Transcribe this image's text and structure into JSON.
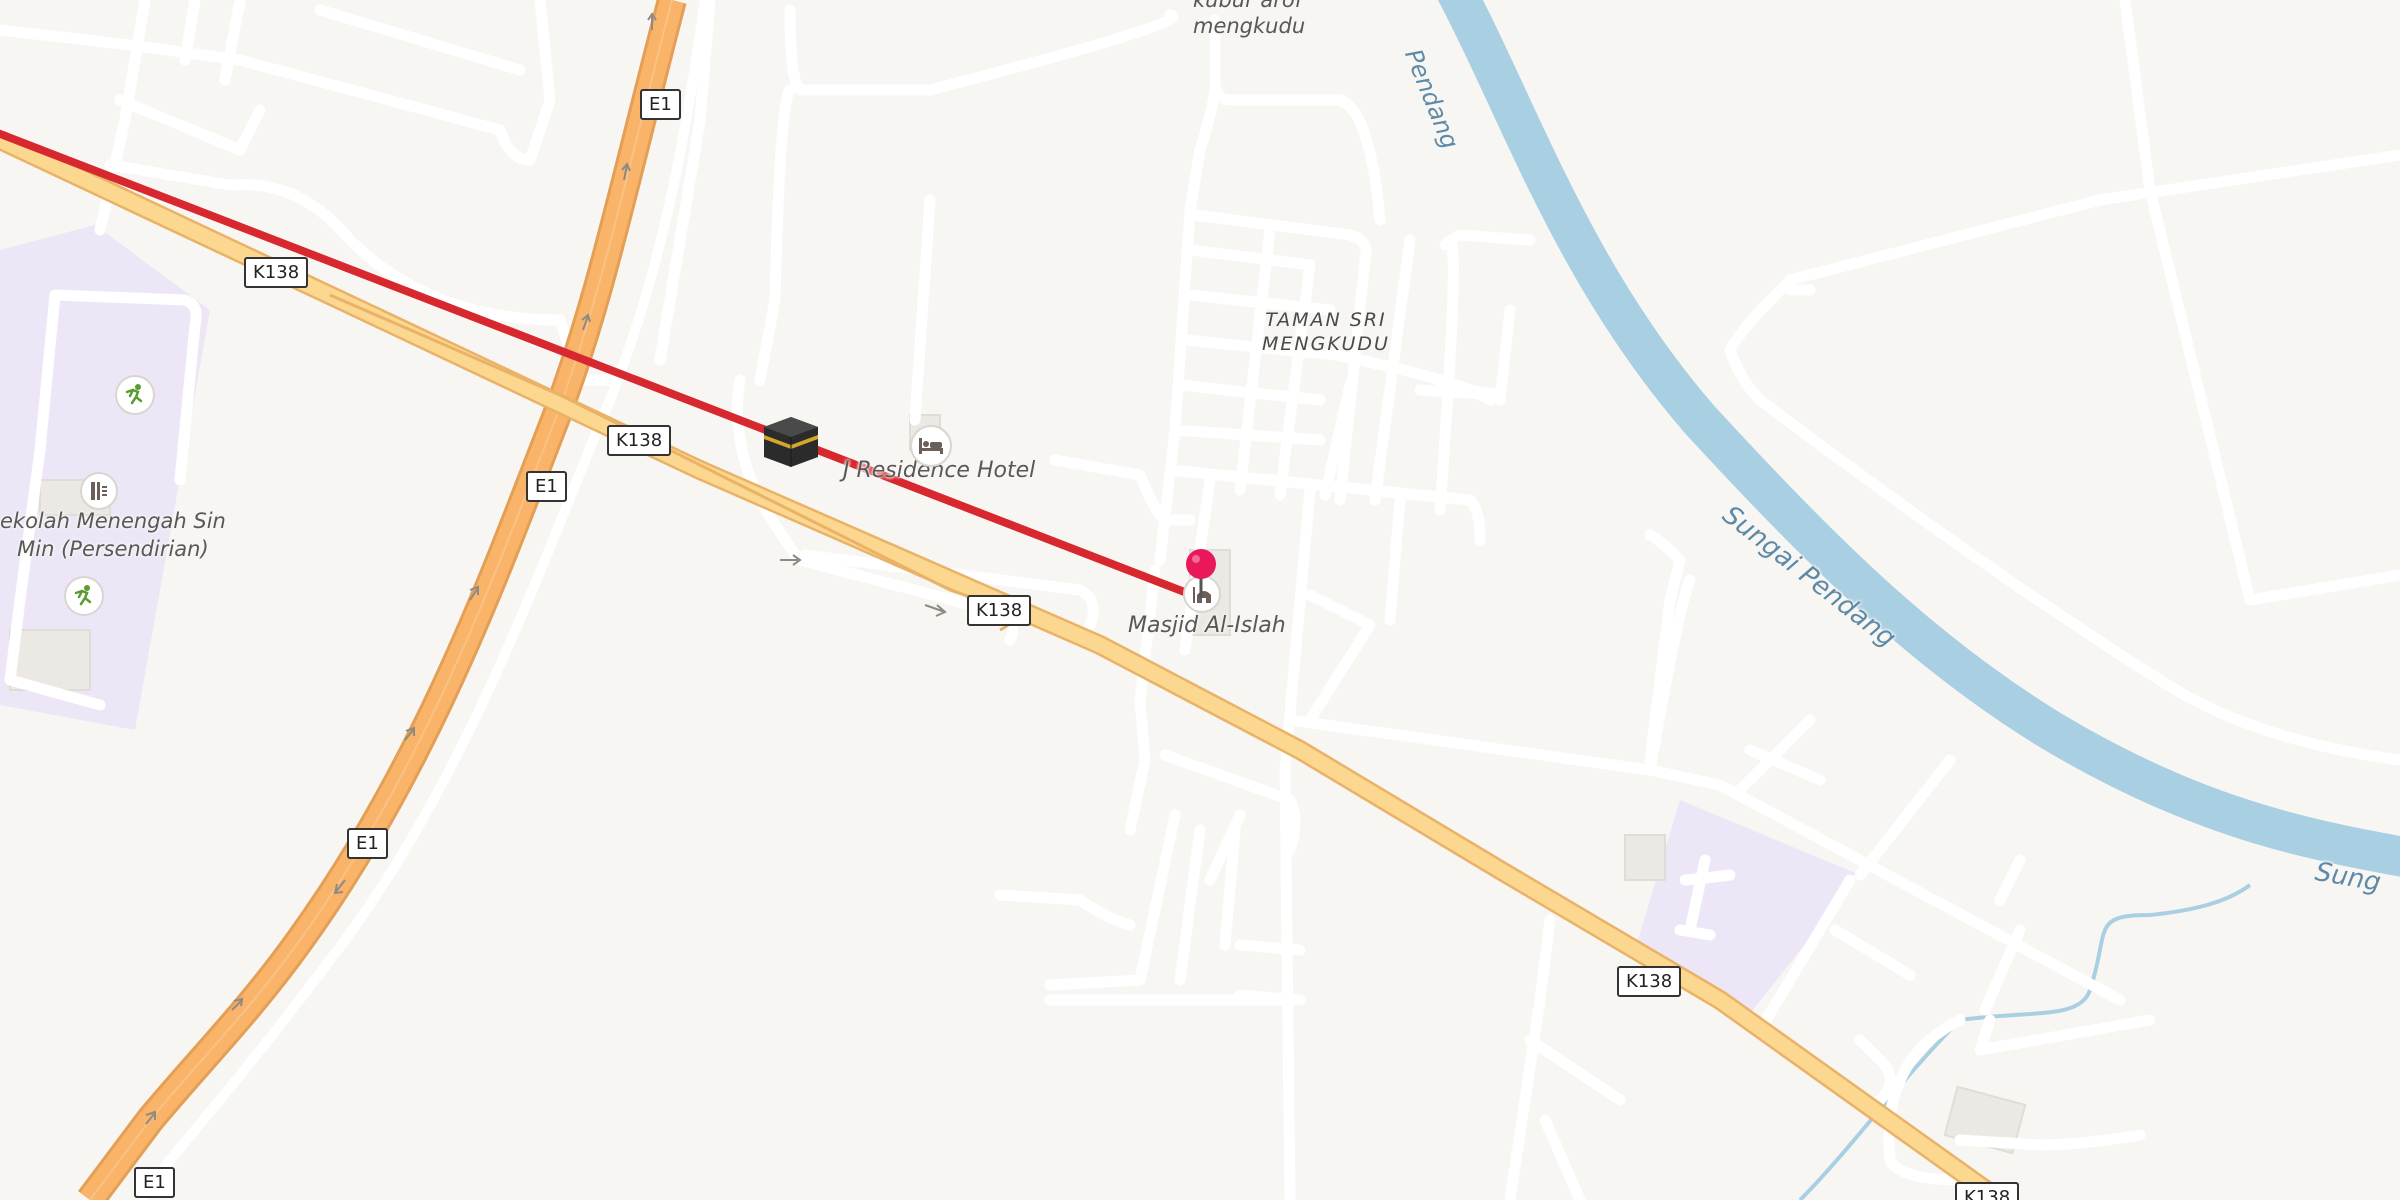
{
  "map": {
    "shields": [
      "E1",
      "E1",
      "E1",
      "E1",
      "K138",
      "K138",
      "K138",
      "K138",
      "K138"
    ],
    "labels": {
      "mengkudu": "kubur arof\nmengkudu",
      "taman": "TAMAN SRI\nMENGKUDU",
      "hotel": "J Residence Hotel",
      "masjid": "Masjid Al-Islah",
      "sekolah": "ekolah Menengah Sin\nMin (Persendirian)"
    },
    "river_names": [
      "Pendang",
      "Sungai Pendang",
      "Sung"
    ],
    "icons": {
      "kaaba": "kaaba-icon",
      "hotel": "bed-icon",
      "mosque": "mosque-icon",
      "school": "school-icon",
      "sports": "runner-icon",
      "pin": "location-pin-icon"
    },
    "colors": {
      "background": "#f8f6f3",
      "motorway": "#f9b46a",
      "trunk": "#fcd790",
      "road": "#ffffff",
      "water": "#a9cfe3",
      "route_line": "#d8282f",
      "pin": "#e8185a",
      "school_area": "#ece6f7"
    }
  }
}
